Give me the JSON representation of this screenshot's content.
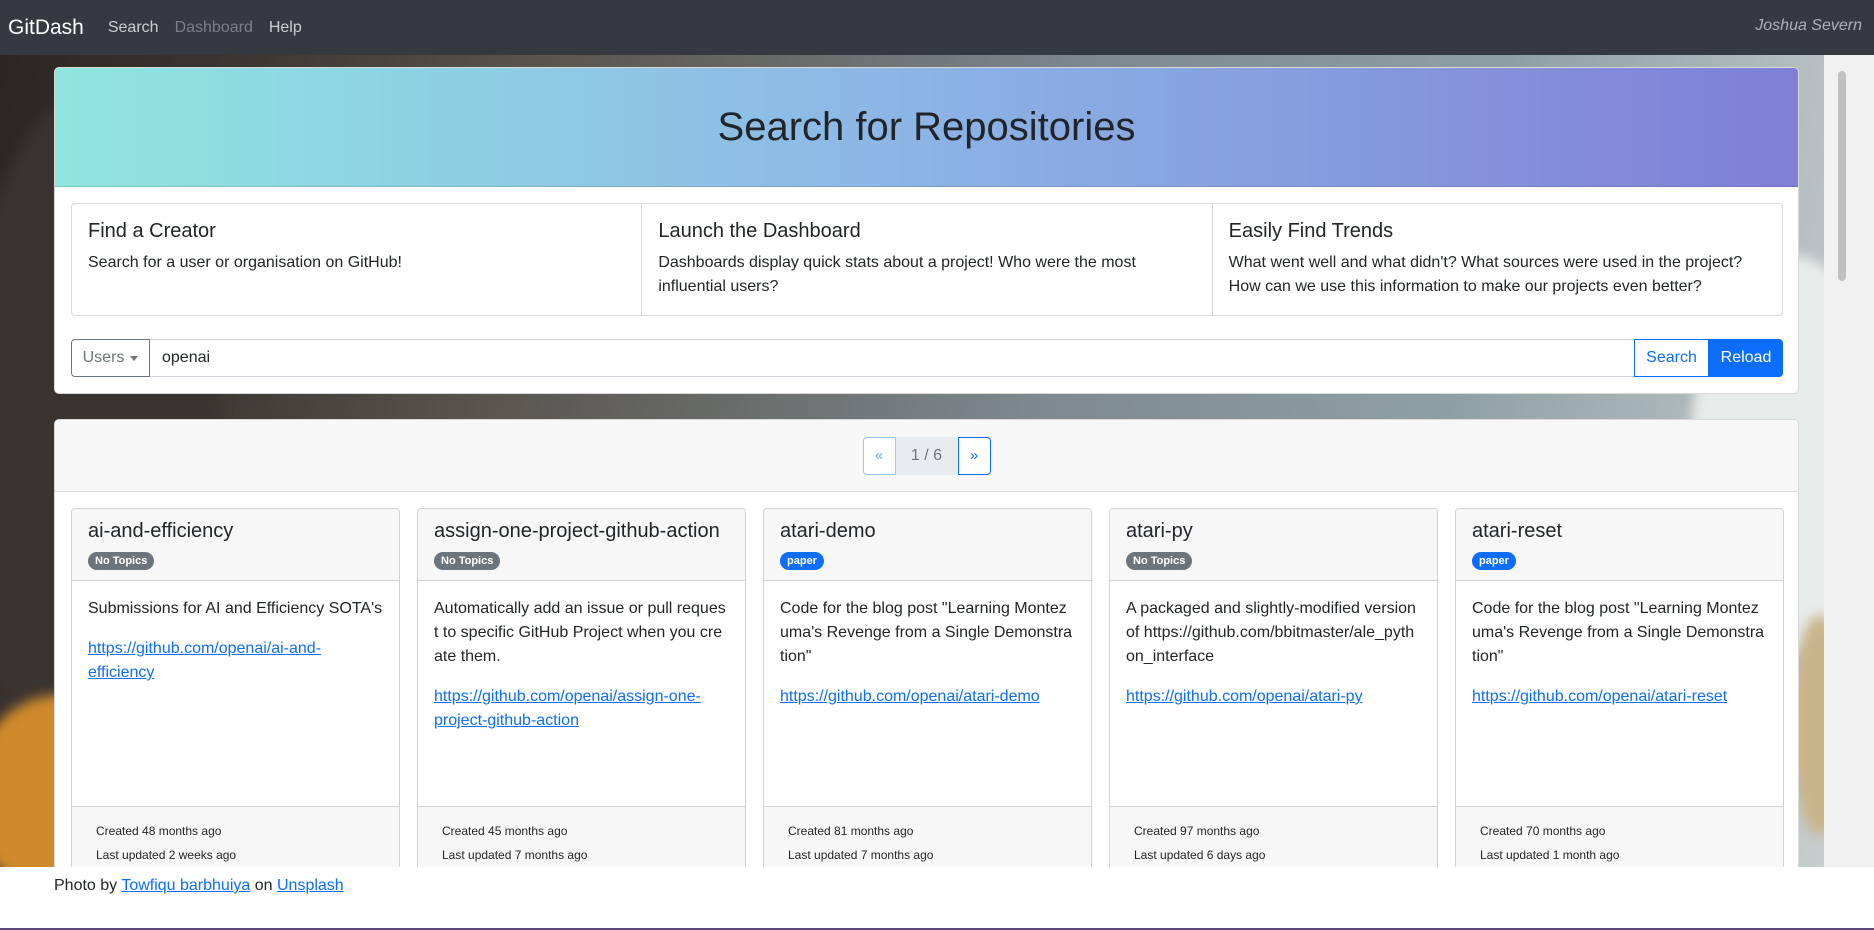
{
  "navbar": {
    "brand": "GitDash",
    "links": [
      "Search",
      "Dashboard",
      "Help"
    ],
    "user": "Joshua Severn"
  },
  "hero": {
    "title": "Search for Repositories",
    "features": [
      {
        "title": "Find a Creator",
        "text": "Search for a user or organisation on GitHub!"
      },
      {
        "title": "Launch the Dashboard",
        "text": "Dashboards display quick stats about a project! Who were the most influential users?"
      },
      {
        "title": "Easily Find Trends",
        "text": "What went well and what didn't? What sources were used in the project? How can we use this information to make our projects even better?"
      }
    ]
  },
  "search": {
    "type_label": "Users",
    "query": "openai",
    "search_label": "Search",
    "reload_label": "Reload"
  },
  "pager": {
    "prev": "«",
    "label": "1 / 6",
    "next": "»"
  },
  "repos": [
    {
      "name": "ai-and-efficiency",
      "topic": "No Topics",
      "topic_color": "#6c757d",
      "description": "Submissions for AI and Efficiency SOTA's",
      "url": "https://github.com/openai/ai-and-efficiency",
      "created": "Created 48 months ago",
      "updated": "Last updated 2 weeks ago"
    },
    {
      "name": "assign-one-project-github-action",
      "topic": "No Topics",
      "topic_color": "#6c757d",
      "description": "Automatically add an issue or pull request to specific GitHub Project when you create them.",
      "url": "https://github.com/openai/assign-one-project-github-action",
      "created": "Created 45 months ago",
      "updated": "Last updated 7 months ago"
    },
    {
      "name": "atari-demo",
      "topic": "paper",
      "topic_color": "#0d6efd",
      "description": "Code for the blog post \"Learning Montezuma's Revenge from a Single Demonstration\"",
      "url": "https://github.com/openai/atari-demo",
      "created": "Created 81 months ago",
      "updated": "Last updated 7 months ago"
    },
    {
      "name": "atari-py",
      "topic": "No Topics",
      "topic_color": "#6c757d",
      "description": "A packaged and slightly-modified version of https://github.com/bbitmaster/ale_python_interface",
      "url": "https://github.com/openai/atari-py",
      "created": "Created 97 months ago",
      "updated": "Last updated 6 days ago"
    },
    {
      "name": "atari-reset",
      "topic": "paper",
      "topic_color": "#0d6efd",
      "description": "Code for the blog post \"Learning Montezuma's Revenge from a Single Demonstration\"",
      "url": "https://github.com/openai/atari-reset",
      "created": "Created 70 months ago",
      "updated": "Last updated 1 month ago"
    }
  ],
  "footer": {
    "prefix": "Photo by",
    "author": "Towfiqu barbhuiya",
    "mid": "on",
    "site": "Unsplash"
  }
}
